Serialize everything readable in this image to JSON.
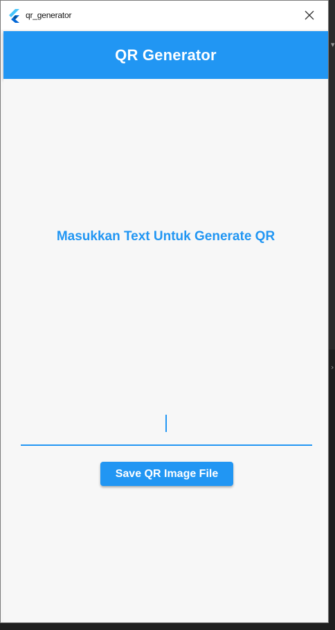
{
  "window": {
    "title": "qr_generator"
  },
  "appbar": {
    "title": "QR Generator"
  },
  "main": {
    "prompt": "Masukkan Text Untuk Generate QR",
    "input_value": "",
    "save_button_label": "Save QR Image File"
  },
  "icons": {
    "app": "flutter-app-icon",
    "close": "close-icon"
  },
  "colors": {
    "primary": "#2196f3",
    "background": "#f7f7f7",
    "titlebar": "#ffffff"
  }
}
